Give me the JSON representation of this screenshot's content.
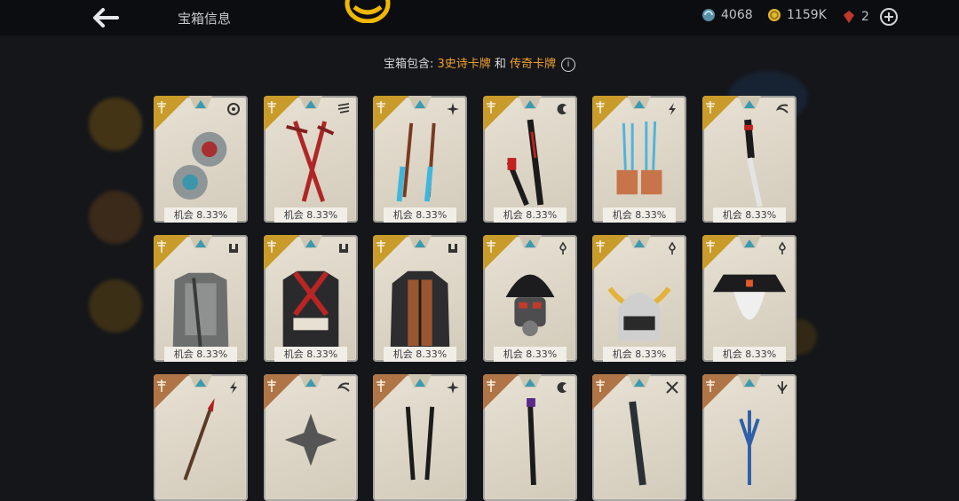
{
  "header": {
    "title": "宝箱信息",
    "resources": {
      "karma": "4068",
      "coins": "1159K",
      "gems": "2"
    }
  },
  "contains": {
    "prefix": "宝箱包含: ",
    "epic": "3史诗卡牌",
    "joiner": " 和 ",
    "legend": "传奇卡牌",
    "info_icon": "i"
  },
  "colors": {
    "background": "#15161a",
    "topbar": "#0c0d10",
    "epic_gold": "#c89b2a",
    "legend_bronze": "#b07546",
    "rarity_triangle": "#3a9ab0",
    "highlight_orange": "#f0a030"
  },
  "cards": [
    {
      "chance": "机会 8.33%",
      "item": "twin-blades-item",
      "type_icon": "shield-icon",
      "rarity": "epic"
    },
    {
      "chance": "机会 8.33%",
      "item": "red-sai-item",
      "type_icon": "wing-icon",
      "rarity": "epic"
    },
    {
      "chance": "机会 8.33%",
      "item": "blue-kunai-item",
      "type_icon": "sparkle-icon",
      "rarity": "epic"
    },
    {
      "chance": "机会 8.33%",
      "item": "red-katana-item",
      "type_icon": "crescent-icon",
      "rarity": "epic"
    },
    {
      "chance": "机会 8.33%",
      "item": "claw-gauntlets-item",
      "type_icon": "lightning-icon",
      "rarity": "epic"
    },
    {
      "chance": "机会 8.33%",
      "item": "dagger-item",
      "type_icon": "swirl-icon",
      "rarity": "epic"
    },
    {
      "chance": "机会 8.33%",
      "item": "grey-armor-item",
      "type_icon": "chestplate-icon",
      "rarity": "epic"
    },
    {
      "chance": "机会 8.33%",
      "item": "red-black-armor-item",
      "type_icon": "chestplate-icon",
      "rarity": "epic"
    },
    {
      "chance": "机会 8.33%",
      "item": "brown-robe-item",
      "type_icon": "chestplate-icon",
      "rarity": "epic"
    },
    {
      "chance": "机会 8.33%",
      "item": "gas-mask-helmet-item",
      "type_icon": "helmet-icon",
      "rarity": "epic"
    },
    {
      "chance": "机会 8.33%",
      "item": "samurai-helmet-item",
      "type_icon": "helmet-icon",
      "rarity": "epic"
    },
    {
      "chance": "机会 8.33%",
      "item": "straw-hat-mask-item",
      "type_icon": "helmet-icon",
      "rarity": "epic"
    },
    {
      "chance": "",
      "item": "spear-item",
      "type_icon": "lightning-icon",
      "rarity": "legend"
    },
    {
      "chance": "",
      "item": "shuriken-item",
      "type_icon": "swirl-icon",
      "rarity": "legend"
    },
    {
      "chance": "",
      "item": "twin-daggers-item",
      "type_icon": "sparkle-icon",
      "rarity": "legend"
    },
    {
      "chance": "",
      "item": "staff-item",
      "type_icon": "crescent-icon",
      "rarity": "legend"
    },
    {
      "chance": "",
      "item": "dark-blade-item",
      "type_icon": "cross-swords-icon",
      "rarity": "legend"
    },
    {
      "chance": "",
      "item": "trident-item",
      "type_icon": "triple-blade-icon",
      "rarity": "legend"
    }
  ]
}
